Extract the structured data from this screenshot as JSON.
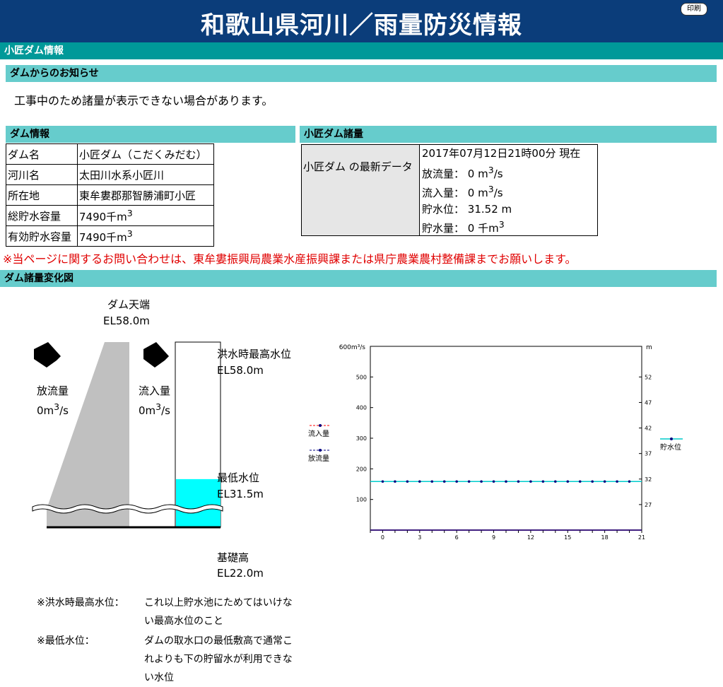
{
  "header": {
    "title": "和歌山県河川／雨量防災情報",
    "print_label": "印刷"
  },
  "section": {
    "title": "小匠ダム情報"
  },
  "notice": {
    "heading": "ダムからのお知らせ",
    "text": "工事中のため諸量が表示できない場合があります。"
  },
  "dam_info": {
    "heading": "ダム情報",
    "rows": [
      {
        "key": "ダム名",
        "value": "小匠ダム（こだくみだむ）"
      },
      {
        "key": "河川名",
        "value": "太田川水系小匠川"
      },
      {
        "key": "所在地",
        "value": "東牟婁郡那智勝浦町小匠"
      },
      {
        "key": "総貯水容量",
        "value": "7490千m",
        "sup": "3"
      },
      {
        "key": "有効貯水容量",
        "value": "7490千m",
        "sup": "3"
      }
    ]
  },
  "dam_stats": {
    "heading": "小匠ダム諸量",
    "key": "小匠ダム の最新データ",
    "timestamp": "2017年07月12日21時00分 現在",
    "outflow": {
      "label": "放流量：",
      "value": "0 m",
      "sup": "3",
      "unit": "/s"
    },
    "inflow": {
      "label": "流入量：",
      "value": "0 m",
      "sup": "3",
      "unit": "/s"
    },
    "level": {
      "label": "貯水位：",
      "value": "31.52 m"
    },
    "storage": {
      "label": "貯水量：",
      "value": "0 千m",
      "sup": "3"
    }
  },
  "warning": "※当ページに関するお問い合わせは、東牟婁振興局農業水産振興課または県庁農業農村整備課までお願いします。",
  "diagram": {
    "heading": "ダム諸量変化図",
    "crest_label": "ダム天端",
    "crest_el": "EL58.0m",
    "outflow_label": "放流量",
    "outflow_value": "0m",
    "outflow_sup": "3",
    "outflow_unit": "/s",
    "inflow_label": "流入量",
    "inflow_value": "0m",
    "inflow_sup": "3",
    "inflow_unit": "/s",
    "flood_label": "洪水時最高水位",
    "flood_el": "EL58.0m",
    "min_label": "最低水位",
    "min_el": "EL31.5m",
    "base_label": "基礎高",
    "base_el": "EL22.0m",
    "current_level_fraction": 0.26
  },
  "notes": [
    {
      "term": "※洪水時最高水位：",
      "desc": "これ以上貯水池にためてはいけない最高水位のこと"
    },
    {
      "term": "※最低水位：",
      "desc": "ダムの取水口の最低敷高で通常これよりも下の貯留水が利用できない水位"
    }
  ],
  "chart_data": {
    "type": "line",
    "x": [
      -1,
      0,
      1,
      2,
      3,
      4,
      5,
      6,
      7,
      8,
      9,
      10,
      11,
      12,
      13,
      14,
      15,
      16,
      17,
      18,
      19,
      20,
      21
    ],
    "x_ticks": [
      "0",
      "3",
      "6",
      "9",
      "12",
      "15",
      "18",
      "21"
    ],
    "y_left_unit": "600m³/s",
    "y_left_ticks": [
      "500",
      "400",
      "300",
      "200",
      "100"
    ],
    "ylim_left": [
      0,
      600
    ],
    "y_right_unit": "m",
    "y_right_ticks": [
      "52",
      "47",
      "42",
      "37",
      "32",
      "27"
    ],
    "ylim_right": [
      22,
      58
    ],
    "series": [
      {
        "name": "流入量",
        "axis": "left",
        "color": "#ff0000",
        "values": [
          0,
          0,
          0,
          0,
          0,
          0,
          0,
          0,
          0,
          0,
          0,
          0,
          0,
          0,
          0,
          0,
          0,
          0,
          0,
          0,
          0,
          0,
          0
        ]
      },
      {
        "name": "放流量",
        "axis": "left",
        "color": "#000080",
        "values": [
          0,
          0,
          0,
          0,
          0,
          0,
          0,
          0,
          0,
          0,
          0,
          0,
          0,
          0,
          0,
          0,
          0,
          0,
          0,
          0,
          0,
          0,
          0
        ]
      },
      {
        "name": "貯水位",
        "axis": "right",
        "color": "#00cccc",
        "values": [
          31.52,
          31.52,
          31.52,
          31.52,
          31.52,
          31.52,
          31.52,
          31.52,
          31.52,
          31.52,
          31.52,
          31.52,
          31.52,
          31.52,
          31.52,
          31.52,
          31.52,
          31.52,
          31.52,
          31.52,
          31.52,
          31.52,
          31.52
        ]
      }
    ],
    "colors": {
      "banner": "#0b3d7a",
      "section": "#009999",
      "subsection": "#66cccc",
      "water": "#00ffff",
      "warning": "#e00000"
    }
  }
}
